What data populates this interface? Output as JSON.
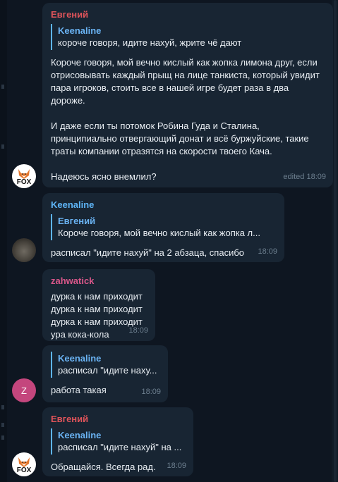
{
  "messages": [
    {
      "sender": "Евгений",
      "reply": {
        "name": "Keenaline",
        "text": "короче говоря, идите нахуй, жрите чё дают"
      },
      "text": "Короче говоря, мой вечно кислый как жопка лимона друг, если отрисовывать каждый прыщ на лице танкиста, который увидит пара игроков, стоить все в нашей игре будет раза в два дороже.\n\nИ даже если ты потомок Робина Гуда и Сталина, принципиально отвергающий донат и всё буржуйские, такие траты компании отразятся на скорости твоего Кача.\n\nНадеюсь ясно внемлил?",
      "edited": "edited",
      "time": "18:09",
      "avatar": "FOX"
    },
    {
      "sender": "Keenaline",
      "reply": {
        "name": "Евгений",
        "text": "Короче говоря, мой вечно кислый как жопка л..."
      },
      "text": "расписал \"идите нахуй\" на 2 абзаца, спасибо",
      "time": "18:09"
    },
    {
      "sender": "zahwatick",
      "text": "дурка к нам приходит\nдурка к нам приходит\nдурка к нам приходит\nура кока-кола",
      "time": "18:09"
    },
    {
      "reply": {
        "name": "Keenaline",
        "text": "расписал \"идите наху..."
      },
      "text": "работа такая",
      "time": "18:09",
      "avatar": "Z"
    },
    {
      "sender": "Евгений",
      "reply": {
        "name": "Keenaline",
        "text": "расписал \"идите нахуй\" на ..."
      },
      "text": "Обращайся. Всегда рад.",
      "time": "18:09",
      "avatar": "FOX"
    }
  ],
  "colors": {
    "background": "#0e1621",
    "bubble": "#182533",
    "sender_red": "#e0545a",
    "sender_blue": "#5eb5f7",
    "sender_pink": "#d9578a",
    "reply_bar": "#5eb5f7",
    "avatar_z": "#c4467d"
  },
  "icons": [
    "fox-avatar-icon",
    "photo-avatar-icon",
    "letter-avatar-icon"
  ]
}
